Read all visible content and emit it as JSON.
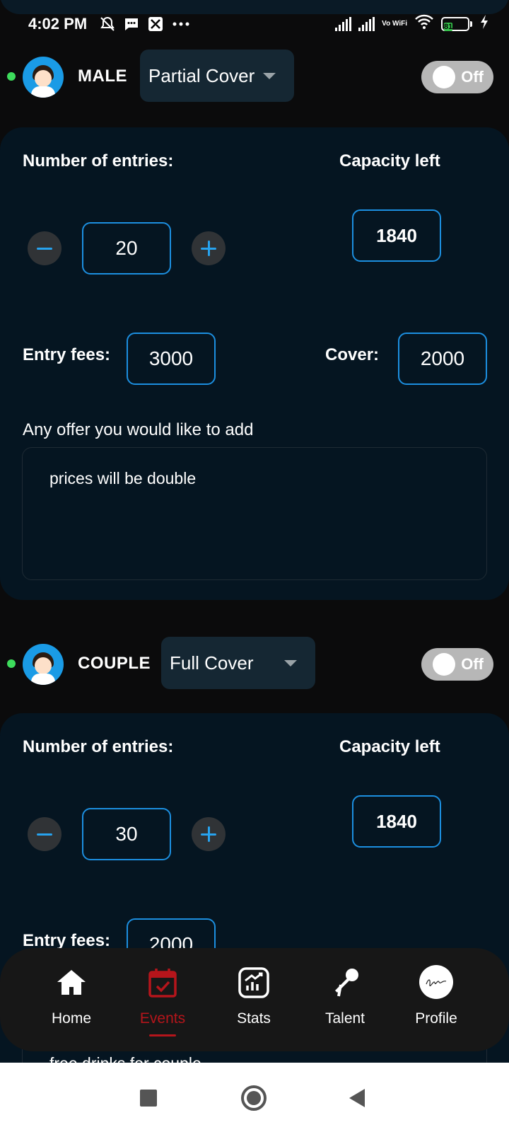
{
  "status_bar": {
    "time": "4:02 PM",
    "left_icons": [
      "mute-icon",
      "message-icon",
      "app-icon",
      "more-icon"
    ],
    "battery_level": "81",
    "vowifi": "Vo WiFi"
  },
  "sections": [
    {
      "category": "MALE",
      "cover_type": "Partial Cover",
      "toggle_label": "Off",
      "entries_label": "Number of entries:",
      "entries_value": "20",
      "capacity_label": "Capacity left",
      "capacity_value": "1840",
      "entry_fees_label": "Entry fees:",
      "entry_fees_value": "3000",
      "cover_label": "Cover:",
      "cover_value": "2000",
      "offer_label": "Any offer you would like to add",
      "offer_text": "prices will be double"
    },
    {
      "category": "COUPLE",
      "cover_type": "Full Cover",
      "toggle_label": "Off",
      "entries_label": "Number of entries:",
      "entries_value": "30",
      "capacity_label": "Capacity left",
      "capacity_value": "1840",
      "entry_fees_label": "Entry fees:",
      "entry_fees_value": "2000",
      "offer_text_partial": "free drinks for couple"
    }
  ],
  "bottom_nav": {
    "items": [
      {
        "label": "Home",
        "icon": "home-icon"
      },
      {
        "label": "Events",
        "icon": "calendar-icon",
        "active": true
      },
      {
        "label": "Stats",
        "icon": "stats-icon"
      },
      {
        "label": "Talent",
        "icon": "microphone-icon"
      },
      {
        "label": "Profile",
        "icon": "profile-avatar"
      }
    ]
  },
  "colors": {
    "background": "#0b0b0c",
    "card": "#051521",
    "dropdown": "#152733",
    "accent_blue": "#1c8fe0",
    "active_red": "#b5151b",
    "online_green": "#3ddc5c"
  }
}
